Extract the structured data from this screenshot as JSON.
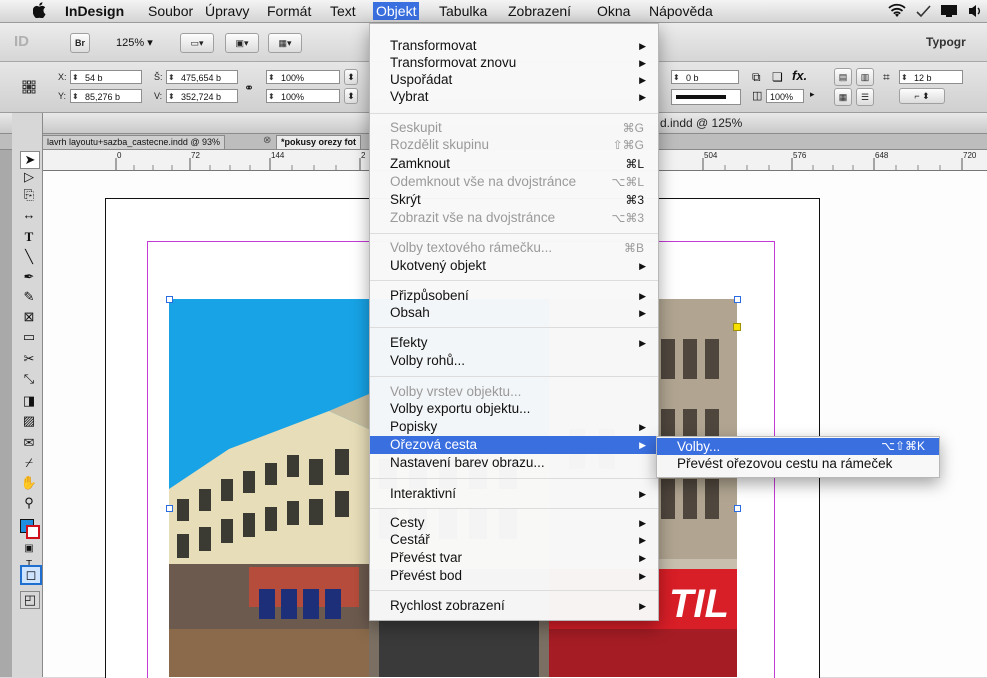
{
  "menubar": {
    "apple": "",
    "items": [
      "InDesign",
      "Soubor",
      "Úpravy",
      "Formát",
      "Text",
      "Objekt",
      "Tabulka",
      "Zobrazení",
      "Okna",
      "Nápověda"
    ]
  },
  "toolbar": {
    "app_badge": "ID",
    "bridge": "Br",
    "zoom": "125%",
    "workspace": "Typogr",
    "x_label": "X:",
    "x_value": "54 b",
    "y_label": "Y:",
    "y_value": "85,276 b",
    "w_label": "Š:",
    "w_value": "475,654 b",
    "h_label": "V:",
    "h_value": "352,724 b",
    "scale_x": "100%",
    "scale_y": "100%",
    "stroke_weight": "0 b",
    "opacity": "100%",
    "corner": "12 b"
  },
  "document": {
    "title": "d.indd @ 125%",
    "tabs": [
      "lavrh layoutu+sazba_castecne.indd @ 93%",
      "*pokusy orezy fot"
    ],
    "ruler_labels": [
      "0",
      "72",
      "144",
      "2",
      "504",
      "576",
      "648",
      "720"
    ],
    "vruler_label": "360"
  },
  "objekt_menu": {
    "items": [
      {
        "label": "Transformovat",
        "arrow": "▶"
      },
      {
        "label": "Transformovat znovu",
        "arrow": "▶"
      },
      {
        "label": "Uspořádat",
        "arrow": "▶"
      },
      {
        "label": "Vybrat",
        "arrow": "▶"
      },
      {
        "label": "Seskupit",
        "shortcut": "⌘G",
        "disabled": true
      },
      {
        "label": "Rozdělit skupinu",
        "shortcut": "⇧⌘G",
        "disabled": true
      },
      {
        "label": "Zamknout",
        "shortcut": "⌘L"
      },
      {
        "label": "Odemknout vše na dvojstránce",
        "shortcut": "⌥⌘L",
        "disabled": true
      },
      {
        "label": "Skrýt",
        "shortcut": "⌘3"
      },
      {
        "label": "Zobrazit vše na dvojstránce",
        "shortcut": "⌥⌘3",
        "disabled": true
      },
      {
        "label": "Volby textového rámečku...",
        "shortcut": "⌘B",
        "disabled": true
      },
      {
        "label": "Ukotvený objekt",
        "arrow": "▶"
      },
      {
        "label": "Přizpůsobení",
        "arrow": "▶"
      },
      {
        "label": "Obsah",
        "arrow": "▶"
      },
      {
        "label": "Efekty",
        "arrow": "▶"
      },
      {
        "label": "Volby rohů..."
      },
      {
        "label": "Volby vrstev objektu...",
        "disabled": true
      },
      {
        "label": "Volby exportu objektu..."
      },
      {
        "label": "Popisky",
        "arrow": "▶"
      },
      {
        "label": "Ořezová cesta",
        "arrow": "▶",
        "highlight": true
      },
      {
        "label": "Nastavení barev obrazu..."
      },
      {
        "label": "Interaktivní",
        "arrow": "▶"
      },
      {
        "label": "Cesty",
        "arrow": "▶"
      },
      {
        "label": "Cestář",
        "arrow": "▶"
      },
      {
        "label": "Převést tvar",
        "arrow": "▶"
      },
      {
        "label": "Převést bod",
        "arrow": "▶"
      },
      {
        "label": "Rychlost zobrazení",
        "arrow": "▶"
      }
    ]
  },
  "submenu": {
    "items": [
      {
        "label": "Volby...",
        "shortcut": "⌥⇧⌘K",
        "highlight": true
      },
      {
        "label": "Převést ořezovou cestu na rámeček"
      }
    ]
  },
  "photo": {
    "sign": "TIL"
  },
  "colors": {
    "menu_highlight": "#3a6fe0",
    "margin_guide": "#c43ad6",
    "sky": "#17a3e6"
  }
}
